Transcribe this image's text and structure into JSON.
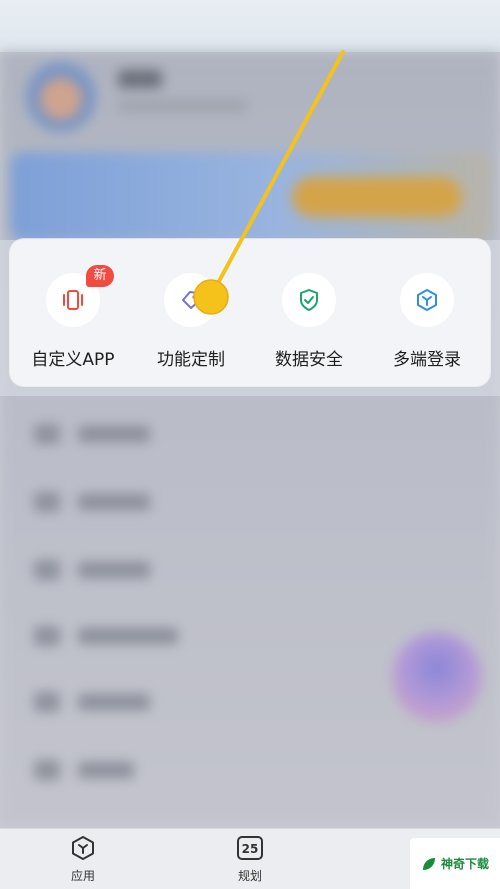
{
  "popup": {
    "features": [
      {
        "label": "自定义APP",
        "icon": "phone-vibrate-icon",
        "badge": "新",
        "color": "#f04a41"
      },
      {
        "label": "功能定制",
        "icon": "tag-icon",
        "color": "#7b6fd6"
      },
      {
        "label": "数据安全",
        "icon": "shield-check-icon",
        "color": "#1aa66a"
      },
      {
        "label": "多端登录",
        "icon": "cube-icon",
        "color": "#2f8ee6"
      }
    ]
  },
  "bottom_nav": {
    "items": [
      {
        "label": "应用",
        "icon": "app-hexagon-icon"
      },
      {
        "label": "规划",
        "icon": "calendar-icon",
        "icon_text": "25"
      }
    ]
  },
  "watermark": {
    "text": "神奇下载"
  },
  "annotation": {
    "color": "#f5c21b"
  }
}
